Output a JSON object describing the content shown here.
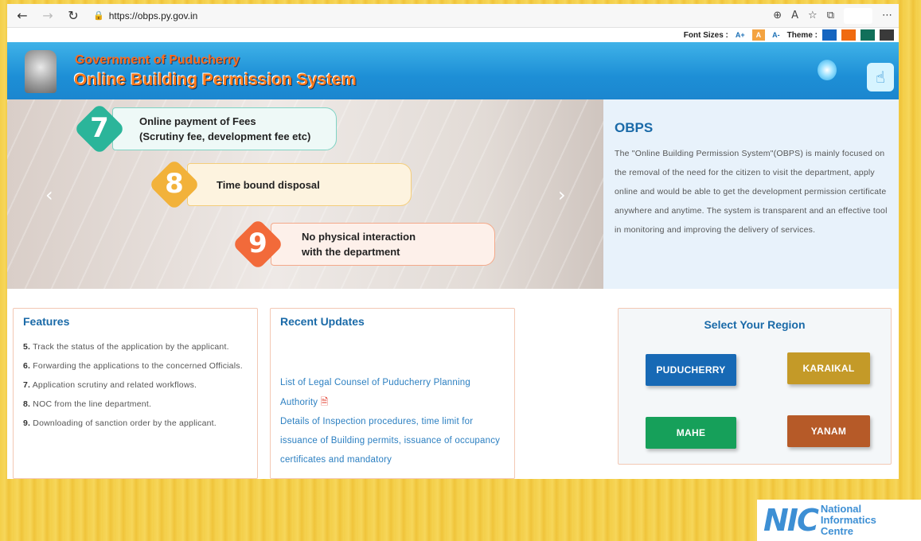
{
  "browser": {
    "url": "https://obps.py.gov.in",
    "icons": [
      "back-icon",
      "forward-icon",
      "refresh-icon",
      "lock-icon",
      "zoom-icon",
      "read-aloud-icon",
      "favorites-icon",
      "collections-icon",
      "more-icon"
    ]
  },
  "accessibility": {
    "font_sizes_label": "Font Sizes :",
    "font_up": "A+",
    "font_normal": "A",
    "font_down": "A-",
    "theme_label": "Theme :",
    "theme_colors": [
      "#1565c0",
      "#f06a10",
      "#11705a",
      "#3a3a3a"
    ]
  },
  "header": {
    "gov_title": "Government of Puducherry",
    "system_title": "Online Building Permission System"
  },
  "slider": {
    "steps": [
      {
        "num": "7",
        "line1": "Online payment of Fees",
        "line2": "(Scrutiny fee, development fee etc)",
        "color": "#2bb59a"
      },
      {
        "num": "8",
        "line1": "Time bound disposal",
        "line2": "",
        "color": "#f2b23a"
      },
      {
        "num": "9",
        "line1": "No physical interaction",
        "line2": "with the department",
        "color": "#f26a3a"
      }
    ]
  },
  "obps": {
    "title": "OBPS",
    "description": "The \"Online Building Permission System\"(OBPS) is mainly focused on the removal of the need for the citizen to visit the department, apply online and would be able to get the development permission certificate anywhere and anytime. The system is transparent and an effective tool in monitoring and improving the delivery of services."
  },
  "features": {
    "title": "Features",
    "items": [
      {
        "n": "5.",
        "text": "Track the status of the application by the applicant."
      },
      {
        "n": "6.",
        "text": "Forwarding the applications to the concerned Officials."
      },
      {
        "n": "7.",
        "text": "Application scrutiny and related workflows."
      },
      {
        "n": "8.",
        "text": "NOC from the line department."
      },
      {
        "n": "9.",
        "text": "Downloading of sanction order by the applicant."
      }
    ]
  },
  "updates": {
    "title": "Recent Updates",
    "items": [
      "List of Legal Counsel of Puducherry Planning Authority",
      "Details of Inspection procedures, time limit for issuance of Building permits, issuance of occupancy certificates and mandatory"
    ]
  },
  "region": {
    "title": "Select Your Region",
    "buttons": [
      {
        "label": "PUDUCHERRY",
        "color": "#1769b5"
      },
      {
        "label": "KARAIKAL",
        "color": "#c49a28"
      },
      {
        "label": "MAHE",
        "color": "#16a05a"
      },
      {
        "label": "YANAM",
        "color": "#b65a28"
      }
    ]
  },
  "nic": {
    "mark": "NIC",
    "line1": "National",
    "line2": "Informatics",
    "line3": "Centre"
  }
}
